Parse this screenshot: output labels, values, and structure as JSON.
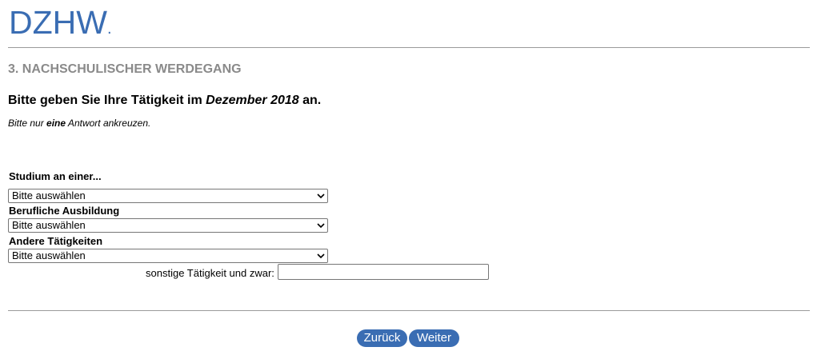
{
  "logo": {
    "text": "DZHW",
    "dot": "."
  },
  "section": {
    "title": "3. NACHSCHULISCHER WERDEGANG"
  },
  "question": {
    "prefix": "Bitte geben Sie Ihre Tätigkeit im ",
    "emphasis": "Dezember 2018",
    "suffix": " an."
  },
  "instruction": {
    "prefix": "Bitte nur ",
    "emphasis": "eine",
    "suffix": " Antwort ankreuzen."
  },
  "groups": [
    {
      "label": "Studium an einer...",
      "selected": "Bitte auswählen"
    },
    {
      "label": "Berufliche Ausbildung",
      "selected": "Bitte auswählen"
    },
    {
      "label": "Andere Tätigkeiten",
      "selected": "Bitte auswählen"
    }
  ],
  "other": {
    "label": "sonstige Tätigkeit und zwar:",
    "value": ""
  },
  "buttons": {
    "back": "Zurück",
    "next": "Weiter"
  },
  "colors": {
    "brand": "#3a6db3",
    "section_title": "#8a8a8a"
  },
  "icons": {
    "select_arrow": "chevron-down-icon"
  }
}
